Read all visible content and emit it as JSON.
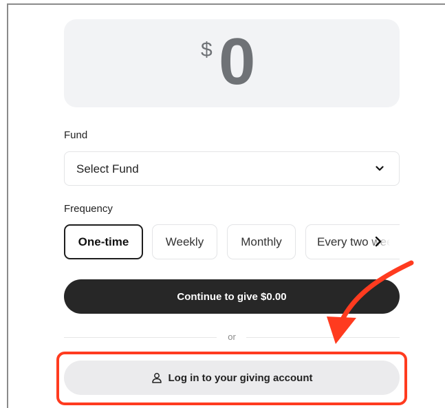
{
  "amount": {
    "currency": "$",
    "value": "0"
  },
  "fund": {
    "label": "Fund",
    "selected": "Select Fund"
  },
  "frequency": {
    "label": "Frequency",
    "options": [
      "One-time",
      "Weekly",
      "Monthly",
      "Every two wee"
    ],
    "selected": "One-time"
  },
  "continue_button": {
    "label": "Continue to give $0.00"
  },
  "divider": {
    "text": "or"
  },
  "login_button": {
    "label": "Log in to your giving account",
    "icon": "person-icon"
  },
  "annotation": {
    "color": "#ff3b1f"
  },
  "colors": {
    "primary_dark": "#272727",
    "card_bg": "#f2f3f5",
    "secondary_btn": "#ebebed"
  }
}
